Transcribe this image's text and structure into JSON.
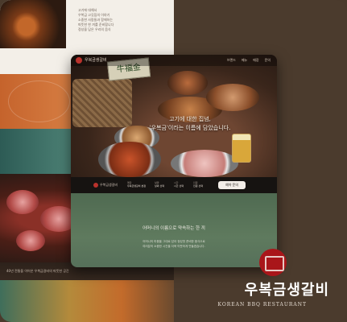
{
  "collage": {
    "top_text": [
      "고기에 대해서",
      "우복금 고깃집의 이야기",
      "",
      "소중한 사람들과 함께하는",
      "따뜻한 한 끼를 준비합니다",
      "정성을 담은 우리의 음식"
    ],
    "bottom_text": "40년 전통을 이어온 우복금갈비의 따뜻한 공간"
  },
  "site": {
    "nav": {
      "brand": "우복금생갈비",
      "menu": [
        "브랜드",
        "메뉴",
        "매장",
        "문의"
      ]
    },
    "sign_text": "牛福金",
    "headline": {
      "line1": "고기에 대한 집념,",
      "line2": "'우복금'이라는 이름에 담았습니다."
    },
    "infobar": {
      "brand": "우복금생갈비",
      "fields": [
        {
          "label": "매장",
          "value": "우복금생갈비 본점"
        },
        {
          "label": "날짜",
          "value": "날짜 선택"
        },
        {
          "label": "시간",
          "value": "시간 선택"
        },
        {
          "label": "인원",
          "value": "인원 선택"
        }
      ],
      "reserve_label": "예약 문의"
    },
    "section": {
      "title": "어머니의 이름으로 약속하는 한 끼",
      "sub": [
        "어머니의 마음을 그대로 담아 정성껏 준비한 음식으로",
        "여러분의 소중한 시간을 더욱 따뜻하게 만들겠습니다."
      ]
    }
  },
  "brand": {
    "name": "우복금생갈비",
    "sub": "KOREAN BBQ RESTAURANT",
    "emblem_color": "#a9161a"
  }
}
